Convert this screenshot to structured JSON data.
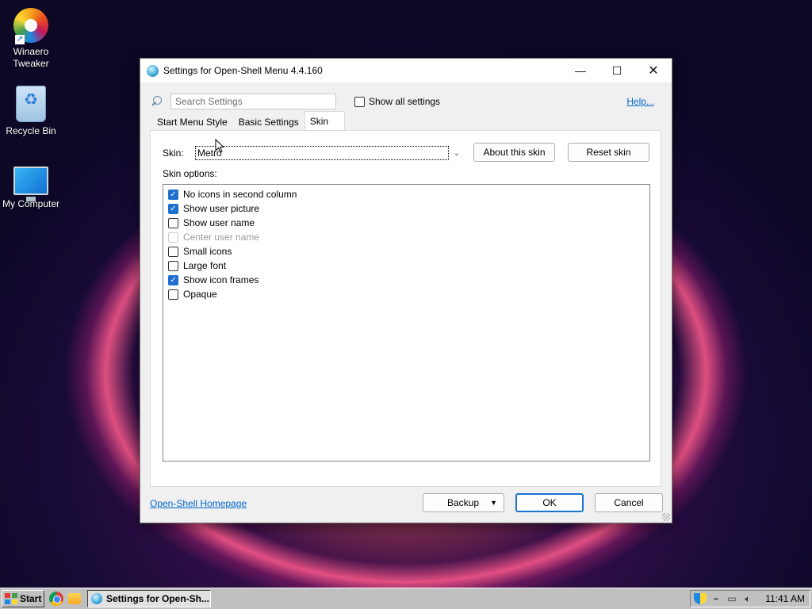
{
  "desktop": {
    "icons": [
      {
        "label": "Winaero Tweaker"
      },
      {
        "label": "Recycle Bin"
      },
      {
        "label": "My Computer"
      }
    ]
  },
  "window": {
    "title": "Settings for Open-Shell Menu 4.4.160",
    "controls": {
      "minimize": "—",
      "maximize": "☐",
      "close": "✕"
    }
  },
  "toolbar": {
    "search_placeholder": "Search Settings",
    "show_all_label": "Show all settings",
    "show_all_checked": false,
    "help_label": "Help..."
  },
  "tabs": [
    {
      "label": "Start Menu Style",
      "active": false
    },
    {
      "label": "Basic Settings",
      "active": false
    },
    {
      "label": "Skin",
      "active": true
    }
  ],
  "skin": {
    "label": "Skin:",
    "value": "Metro",
    "about_label": "About this skin",
    "reset_label": "Reset skin",
    "options_label": "Skin options:",
    "options": [
      {
        "label": "No icons in second column",
        "checked": true,
        "disabled": false
      },
      {
        "label": "Show user picture",
        "checked": true,
        "disabled": false
      },
      {
        "label": "Show user name",
        "checked": false,
        "disabled": false
      },
      {
        "label": "Center user name",
        "checked": false,
        "disabled": true
      },
      {
        "label": "Small icons",
        "checked": false,
        "disabled": false
      },
      {
        "label": "Large font",
        "checked": false,
        "disabled": false
      },
      {
        "label": "Show icon frames",
        "checked": true,
        "disabled": false
      },
      {
        "label": "Opaque",
        "checked": false,
        "disabled": false
      }
    ]
  },
  "footer": {
    "homepage_label": "Open-Shell Homepage",
    "backup_label": "Backup",
    "ok_label": "OK",
    "cancel_label": "Cancel"
  },
  "taskbar": {
    "start_label": "Start",
    "task_label": "Settings for Open-Sh...",
    "clock": "11:41 AM"
  }
}
